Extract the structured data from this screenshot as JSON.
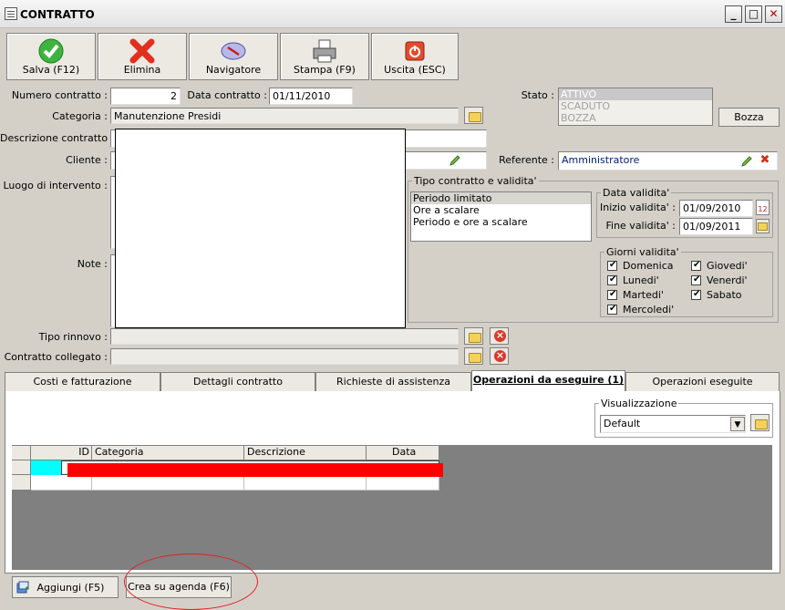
{
  "window": {
    "title": "CONTRATTO"
  },
  "toolbar": {
    "save": "Salva (F12)",
    "delete": "Elimina",
    "navigator": "Navigatore",
    "print": "Stampa (F9)",
    "exit": "Uscita (ESC)"
  },
  "form": {
    "numero_label": "Numero contratto :",
    "numero_value": "2",
    "data_label": "Data contratto :",
    "data_value": "01/11/2010",
    "stato_label": "Stato :",
    "stato_options": [
      "ATTIVO",
      "SCADUTO",
      "BOZZA"
    ],
    "bozza_button": "Bozza",
    "categoria_label": "Categoria :",
    "categoria_value": "Manutenzione Presidi",
    "descrizione_label": "Descrizione contratto :",
    "cliente_label": "Cliente :",
    "referente_label": "Referente :",
    "referente_value": "Amministratore",
    "luogo_label": "Luogo di intervento :",
    "note_label": "Note :",
    "tipo_rinnovo_label": "Tipo rinnovo :",
    "contratto_collegato_label": "Contratto collegato :"
  },
  "validity": {
    "group_title": "Tipo contratto e validita'",
    "types": [
      "Periodo limitato",
      "Ore a scalare",
      "Periodo e ore a scalare"
    ],
    "data_group_title": "Data validita'",
    "inizio_label": "Inizio validita' :",
    "inizio_value": "01/09/2010",
    "fine_label": "Fine validita' :",
    "fine_value": "01/09/2011",
    "calendar_day": "12",
    "giorni_title": "Giorni validita'",
    "days_left": [
      "Domenica",
      "Lunedi'",
      "Martedi'",
      "Mercoledi'"
    ],
    "days_right": [
      "Giovedi'",
      "Venerdi'",
      "Sabato"
    ]
  },
  "tabs": [
    "Costi e fatturazione",
    "Dettagli contratto",
    "Richieste di assistenza",
    "Operazioni da eseguire (1)",
    "Operazioni eseguite"
  ],
  "visualizzazione": {
    "title": "Visualizzazione",
    "value": "Default"
  },
  "grid": {
    "columns": [
      "ID",
      "Categoria",
      "Descrizione",
      "Data"
    ]
  },
  "bottom": {
    "add": "Aggiungi (F5)",
    "agenda": "Crea su agenda (F6)"
  },
  "colors": {
    "accent_red": "#ff0000",
    "row_marker": "#00ffff",
    "grid_bg": "#808080"
  }
}
